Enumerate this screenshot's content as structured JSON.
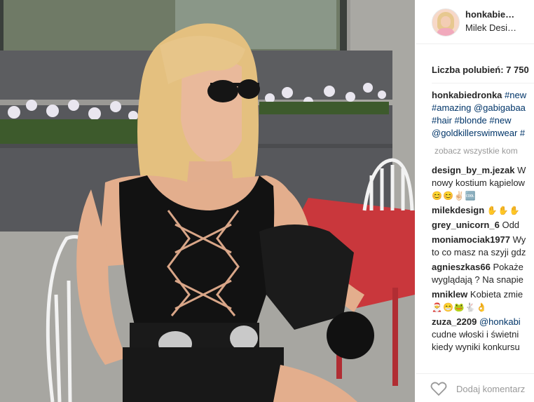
{
  "post": {
    "username": "honkabie…",
    "location": "Milek Desi…",
    "likes_text": "Liczba polubień: 7 750",
    "caption": {
      "author": "honkabiedronka",
      "lines": [
        "#new",
        "#amazing @gabigabaa",
        "#hair #blonde #new",
        "@goldkillerswimwear #"
      ]
    },
    "view_all": "zobacz wszystkie kom",
    "comments": [
      {
        "user": "design_by_m.jezak",
        "lines": [
          "W",
          "nowy kostium kąpielow"
        ],
        "emoji": "😊😊✌🏻🆒"
      },
      {
        "user": "milekdesign",
        "lines": [
          ""
        ],
        "emoji": "✋✋✋"
      },
      {
        "user": "grey_unicorn_6",
        "lines": [
          "Odd"
        ],
        "emoji": ""
      },
      {
        "user": "moniamociak1977",
        "lines": [
          "Wy",
          "to co masz na szyji gdz"
        ],
        "emoji": ""
      },
      {
        "user": "agnieszkas66",
        "lines": [
          "Pokaże",
          "wyglądają ? Na snapie"
        ],
        "emoji": ""
      },
      {
        "user": "mniklew",
        "lines": [
          "Kobieta zmie"
        ],
        "emoji": "🎅😁🐸🐇👌"
      },
      {
        "user": "zuza_2209",
        "lines": [
          "@honkabi",
          "cudne włoski i świetni",
          "kiedy wyniki konkursu"
        ],
        "emoji": ""
      }
    ],
    "add_comment_placeholder": "Dodaj komentarz",
    "icons": {
      "like": "heart-icon"
    }
  }
}
